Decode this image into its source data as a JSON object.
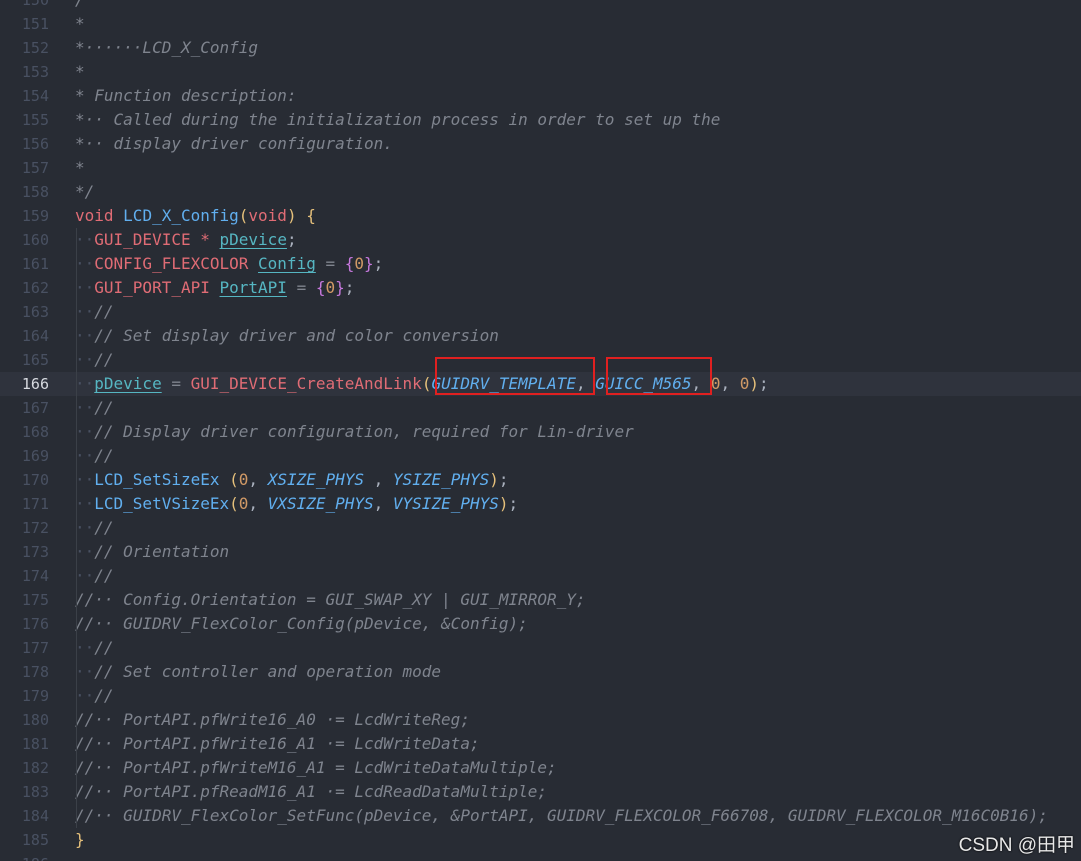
{
  "editor": {
    "lines": [
      {
        "n": "150",
        "segs": [
          {
            "t": "/",
            "c": "c"
          }
        ]
      },
      {
        "n": "151",
        "segs": [
          {
            "t": "*",
            "c": "c"
          }
        ]
      },
      {
        "n": "152",
        "segs": [
          {
            "t": "*······LCD_X_Config",
            "c": "c"
          }
        ]
      },
      {
        "n": "153",
        "segs": [
          {
            "t": "*",
            "c": "c"
          }
        ]
      },
      {
        "n": "154",
        "segs": [
          {
            "t": "* Function description:",
            "c": "c"
          }
        ]
      },
      {
        "n": "155",
        "segs": [
          {
            "t": "*·· Called during the initialization process in order to set up the",
            "c": "c"
          }
        ]
      },
      {
        "n": "156",
        "segs": [
          {
            "t": "*·· display driver configuration.",
            "c": "c"
          }
        ]
      },
      {
        "n": "157",
        "segs": [
          {
            "t": "*",
            "c": "c"
          }
        ]
      },
      {
        "n": "158",
        "segs": [
          {
            "t": "*/",
            "c": "c"
          }
        ]
      },
      {
        "n": "159",
        "segs": [
          {
            "t": "void ",
            "c": "ty"
          },
          {
            "t": "LCD_X_Config",
            "c": "fn"
          },
          {
            "t": "(",
            "c": "br1"
          },
          {
            "t": "void",
            "c": "ty"
          },
          {
            "t": ")",
            "c": "br1"
          },
          {
            "t": " ",
            "c": "pl"
          },
          {
            "t": "{",
            "c": "br1"
          }
        ]
      },
      {
        "n": "160",
        "segs": [
          {
            "t": "··",
            "c": "dot"
          },
          {
            "t": "GUI_DEVICE",
            "c": "ty"
          },
          {
            "t": " ",
            "c": "pl"
          },
          {
            "t": "*",
            "c": "ty"
          },
          {
            "t": " ",
            "c": "pl"
          },
          {
            "t": "pDevice",
            "c": "id"
          },
          {
            "t": ";",
            "c": "pl"
          }
        ]
      },
      {
        "n": "161",
        "segs": [
          {
            "t": "··",
            "c": "dot"
          },
          {
            "t": "CONFIG_FLEXCOLOR",
            "c": "ty"
          },
          {
            "t": " ",
            "c": "pl"
          },
          {
            "t": "Config",
            "c": "id"
          },
          {
            "t": " ",
            "c": "pl"
          },
          {
            "t": "=",
            "c": "c"
          },
          {
            "t": " ",
            "c": "pl"
          },
          {
            "t": "{",
            "c": "br2"
          },
          {
            "t": "0",
            "c": "nu"
          },
          {
            "t": "}",
            "c": "br2"
          },
          {
            "t": ";",
            "c": "pl"
          }
        ]
      },
      {
        "n": "162",
        "segs": [
          {
            "t": "··",
            "c": "dot"
          },
          {
            "t": "GUI_PORT_API",
            "c": "ty"
          },
          {
            "t": " ",
            "c": "pl"
          },
          {
            "t": "PortAPI",
            "c": "id"
          },
          {
            "t": " ",
            "c": "pl"
          },
          {
            "t": "=",
            "c": "c"
          },
          {
            "t": " ",
            "c": "pl"
          },
          {
            "t": "{",
            "c": "br2"
          },
          {
            "t": "0",
            "c": "nu"
          },
          {
            "t": "}",
            "c": "br2"
          },
          {
            "t": ";",
            "c": "pl"
          }
        ]
      },
      {
        "n": "163",
        "segs": [
          {
            "t": "··",
            "c": "dot"
          },
          {
            "t": "//",
            "c": "c"
          }
        ]
      },
      {
        "n": "164",
        "segs": [
          {
            "t": "··",
            "c": "dot"
          },
          {
            "t": "// Set display driver and color conversion",
            "c": "c"
          }
        ]
      },
      {
        "n": "165",
        "segs": [
          {
            "t": "··",
            "c": "dot"
          },
          {
            "t": "//",
            "c": "c"
          }
        ]
      },
      {
        "n": "166",
        "segs": [
          {
            "t": "··",
            "c": "dot"
          },
          {
            "t": "pDevice",
            "c": "id"
          },
          {
            "t": " ",
            "c": "pl"
          },
          {
            "t": "=",
            "c": "c"
          },
          {
            "t": " ",
            "c": "pl"
          },
          {
            "t": "GUI_DEVICE_CreateAndLink",
            "c": "ty"
          },
          {
            "t": "(",
            "c": "br1"
          },
          {
            "t": "GUIDRV_TEMPLATE",
            "c": "mc"
          },
          {
            "t": ", ",
            "c": "pl"
          },
          {
            "t": "GUICC_M565",
            "c": "mc"
          },
          {
            "t": ", ",
            "c": "pl"
          },
          {
            "t": "0",
            "c": "nu"
          },
          {
            "t": ", ",
            "c": "pl"
          },
          {
            "t": "0",
            "c": "nu"
          },
          {
            "t": ")",
            "c": "br1"
          },
          {
            "t": ";",
            "c": "pl"
          }
        ]
      },
      {
        "n": "167",
        "segs": [
          {
            "t": "··",
            "c": "dot"
          },
          {
            "t": "//",
            "c": "c"
          }
        ]
      },
      {
        "n": "168",
        "segs": [
          {
            "t": "··",
            "c": "dot"
          },
          {
            "t": "// Display driver configuration, required for Lin-driver",
            "c": "c"
          }
        ]
      },
      {
        "n": "169",
        "segs": [
          {
            "t": "··",
            "c": "dot"
          },
          {
            "t": "//",
            "c": "c"
          }
        ]
      },
      {
        "n": "170",
        "segs": [
          {
            "t": "··",
            "c": "dot"
          },
          {
            "t": "LCD_SetSizeEx",
            "c": "fn"
          },
          {
            "t": " ",
            "c": "pl"
          },
          {
            "t": "(",
            "c": "br1"
          },
          {
            "t": "0",
            "c": "nu"
          },
          {
            "t": ", ",
            "c": "pl"
          },
          {
            "t": "XSIZE_PHYS",
            "c": "mc"
          },
          {
            "t": " , ",
            "c": "pl"
          },
          {
            "t": "YSIZE_PHYS",
            "c": "mc"
          },
          {
            "t": ")",
            "c": "br1"
          },
          {
            "t": ";",
            "c": "pl"
          }
        ]
      },
      {
        "n": "171",
        "segs": [
          {
            "t": "··",
            "c": "dot"
          },
          {
            "t": "LCD_SetVSizeEx",
            "c": "fn"
          },
          {
            "t": "(",
            "c": "br1"
          },
          {
            "t": "0",
            "c": "nu"
          },
          {
            "t": ", ",
            "c": "pl"
          },
          {
            "t": "VXSIZE_PHYS",
            "c": "mc"
          },
          {
            "t": ", ",
            "c": "pl"
          },
          {
            "t": "VYSIZE_PHYS",
            "c": "mc"
          },
          {
            "t": ")",
            "c": "br1"
          },
          {
            "t": ";",
            "c": "pl"
          }
        ]
      },
      {
        "n": "172",
        "segs": [
          {
            "t": "··",
            "c": "dot"
          },
          {
            "t": "//",
            "c": "c"
          }
        ]
      },
      {
        "n": "173",
        "segs": [
          {
            "t": "··",
            "c": "dot"
          },
          {
            "t": "// Orientation",
            "c": "c"
          }
        ]
      },
      {
        "n": "174",
        "segs": [
          {
            "t": "··",
            "c": "dot"
          },
          {
            "t": "//",
            "c": "c"
          }
        ]
      },
      {
        "n": "175",
        "segs": [
          {
            "t": "//·· Config.Orientation = GUI_SWAP_XY | GUI_MIRROR_Y;",
            "c": "c"
          }
        ]
      },
      {
        "n": "176",
        "segs": [
          {
            "t": "//·· GUIDRV_FlexColor_Config(pDevice, &Config);",
            "c": "c"
          }
        ]
      },
      {
        "n": "177",
        "segs": [
          {
            "t": "··",
            "c": "dot"
          },
          {
            "t": "//",
            "c": "c"
          }
        ]
      },
      {
        "n": "178",
        "segs": [
          {
            "t": "··",
            "c": "dot"
          },
          {
            "t": "// Set controller and operation mode",
            "c": "c"
          }
        ]
      },
      {
        "n": "179",
        "segs": [
          {
            "t": "··",
            "c": "dot"
          },
          {
            "t": "//",
            "c": "c"
          }
        ]
      },
      {
        "n": "180",
        "segs": [
          {
            "t": "//·· PortAPI.pfWrite16_A0 ·= LcdWriteReg;",
            "c": "c"
          }
        ]
      },
      {
        "n": "181",
        "segs": [
          {
            "t": "//·· PortAPI.pfWrite16_A1 ·= LcdWriteData;",
            "c": "c"
          }
        ]
      },
      {
        "n": "182",
        "segs": [
          {
            "t": "//·· PortAPI.pfWriteM16_A1 = LcdWriteDataMultiple;",
            "c": "c"
          }
        ]
      },
      {
        "n": "183",
        "segs": [
          {
            "t": "//·· PortAPI.pfReadM16_A1 ·= LcdReadDataMultiple;",
            "c": "c"
          }
        ]
      },
      {
        "n": "184",
        "segs": [
          {
            "t": "//·· GUIDRV_FlexColor_SetFunc(pDevice, &PortAPI, GUIDRV_FLEXCOLOR_F66708, GUIDRV_FLEXCOLOR_M16C0B16);",
            "c": "c"
          }
        ]
      },
      {
        "n": "185",
        "segs": [
          {
            "t": "}",
            "c": "br1"
          }
        ]
      },
      {
        "n": "186",
        "segs": []
      }
    ],
    "current_line": "166"
  },
  "watermark": "CSDN @田甲"
}
